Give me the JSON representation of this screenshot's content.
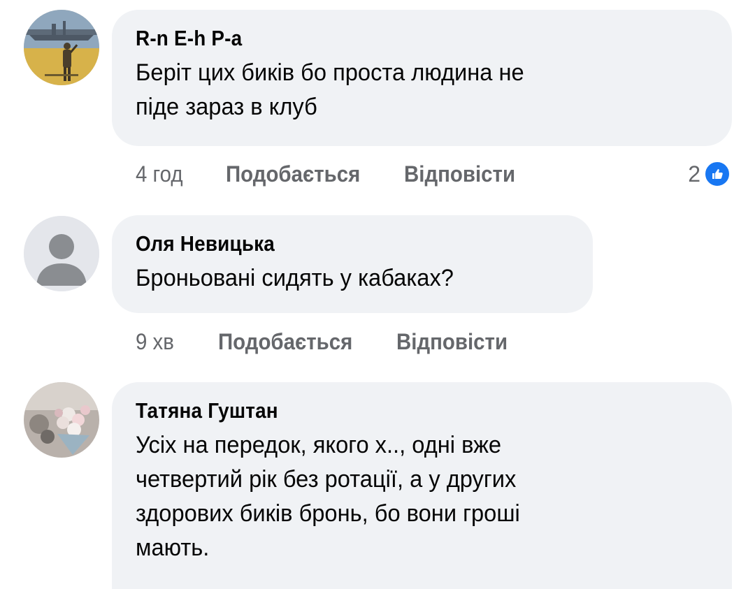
{
  "comments": [
    {
      "author": "R-n E-h P-a",
      "text": "Беріт цих биків бо проста людина не\nпіде зараз в клуб",
      "time": "4 год",
      "like_label": "Подобається",
      "reply_label": "Відповісти",
      "reaction_count": "2",
      "reaction_icon": "like-icon",
      "avatar": "photo-avatar"
    },
    {
      "author": "Оля Невицька",
      "text": "Броньовані сидять у кабаках?",
      "time": "9 хв",
      "like_label": "Подобається",
      "reply_label": "Відповісти",
      "avatar": "default-avatar"
    },
    {
      "author": "Татяна Гуштан",
      "text": "Усіх на передок, якого х.., одні вже\nчетвертий рік без ротації,  а у других\nздорових биків бронь,  бо вони гроші\nмають.",
      "avatar": "photo-avatar"
    }
  ],
  "colors": {
    "bubble": "#f0f2f5",
    "meta_text": "#65676b",
    "like_blue": "#1877f2"
  }
}
